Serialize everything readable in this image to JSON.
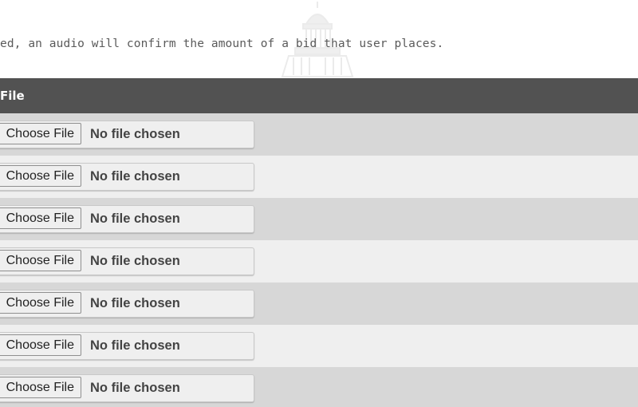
{
  "intro_text": "ed, an audio will confirm the amount of a bid that user places.",
  "table": {
    "header_label": "File",
    "rows": [
      {
        "button_label": "Choose File",
        "status": "No file chosen"
      },
      {
        "button_label": "Choose File",
        "status": "No file chosen"
      },
      {
        "button_label": "Choose File",
        "status": "No file chosen"
      },
      {
        "button_label": "Choose File",
        "status": "No file chosen"
      },
      {
        "button_label": "Choose File",
        "status": "No file chosen"
      },
      {
        "button_label": "Choose File",
        "status": "No file chosen"
      },
      {
        "button_label": "Choose File",
        "status": "No file chosen"
      }
    ]
  },
  "colors": {
    "header_bg": "#525252",
    "row_odd": "#d7d7d7",
    "row_even": "#efefef"
  },
  "icons": {
    "watermark": "capitol-building-icon"
  }
}
